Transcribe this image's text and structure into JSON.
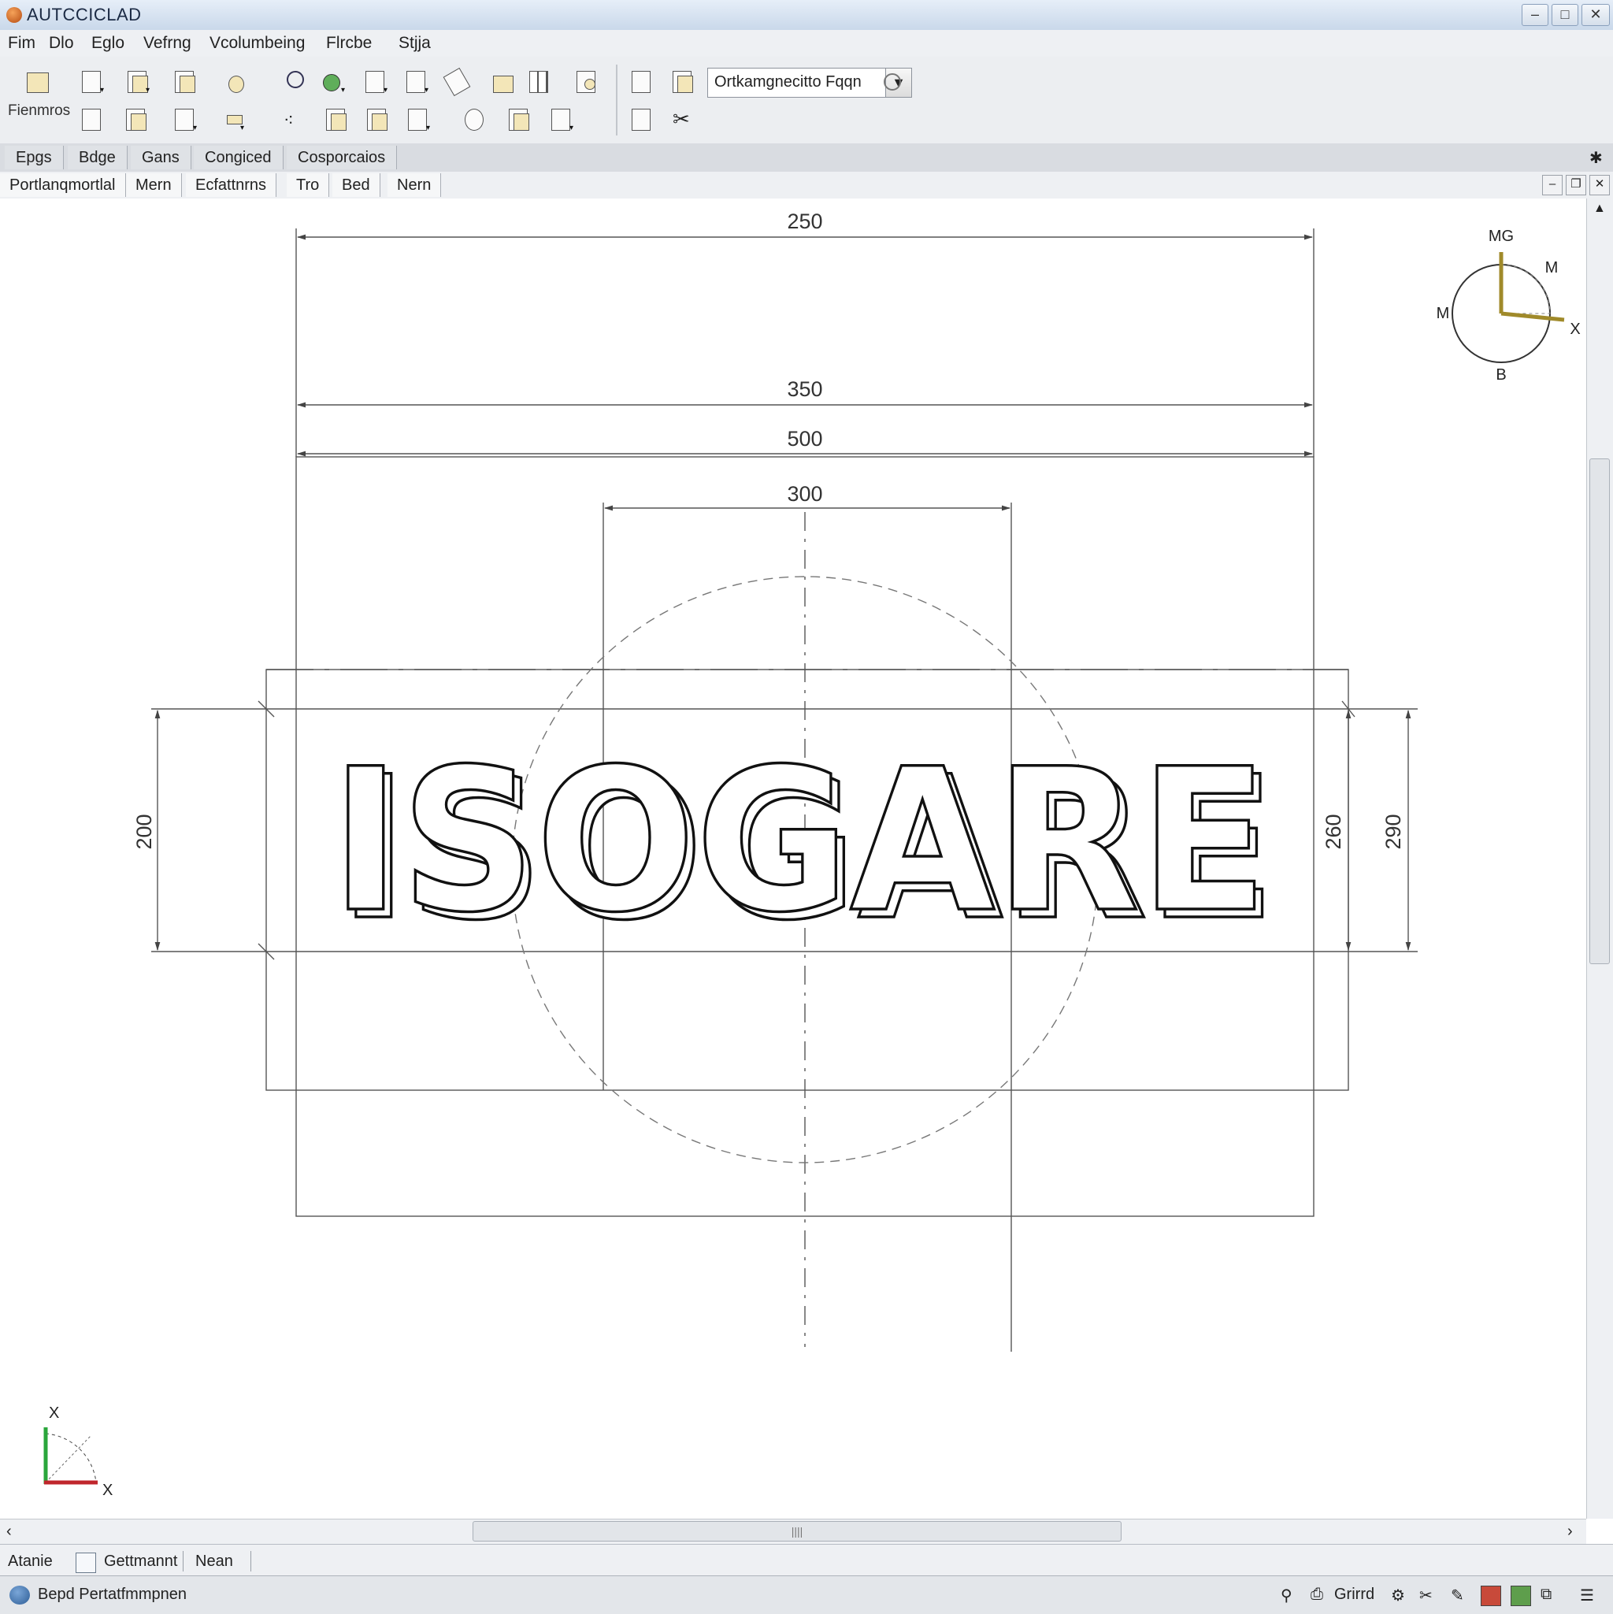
{
  "window": {
    "title": "AUTCCICLAD",
    "controls": [
      "–",
      "□",
      "✕"
    ]
  },
  "menu": [
    "Fim",
    "Dlo",
    "Eglo",
    "Vefrng",
    "Vcolumbeing",
    "Flrcbe",
    "Stjja"
  ],
  "toolbar": {
    "group_label": "Fienmros",
    "layer_combo": "Ortkamgnecitto  Fqqn"
  },
  "ribbon_tabs": [
    "Epgs",
    "Bdge",
    "Gans",
    "Congiced",
    "Cosporcaios"
  ],
  "doc_tabs": [
    "Portlanqmortlal",
    "Mern",
    "Ecfattnrns",
    "Tro",
    "Bed",
    "Nern"
  ],
  "drawing": {
    "wordmark": "ISOGARE",
    "dimensions": {
      "top_1": "250",
      "top_2": "350",
      "top_3": "500",
      "top_4": "300",
      "left": "200",
      "right_1": "260",
      "right_2": "290"
    },
    "viewcube_labels": {
      "top": "MG",
      "top_right": "M",
      "left": "M",
      "right": "X",
      "bottom": "B"
    },
    "ucs_labels": {
      "y": "X",
      "x": "X"
    }
  },
  "layout_tabs": [
    "Atanie",
    "Gettmannt",
    "Nean"
  ],
  "status": {
    "text": "Bepd  Pertatfmmpnen",
    "grid_label": "Grirrd"
  },
  "colors": {
    "titlebar": "#c9d8ea",
    "chrome": "#eceef1",
    "canvas": "#ffffff",
    "line": "#555555",
    "ucs_x": "#c0262c",
    "ucs_y": "#2aa63b"
  }
}
